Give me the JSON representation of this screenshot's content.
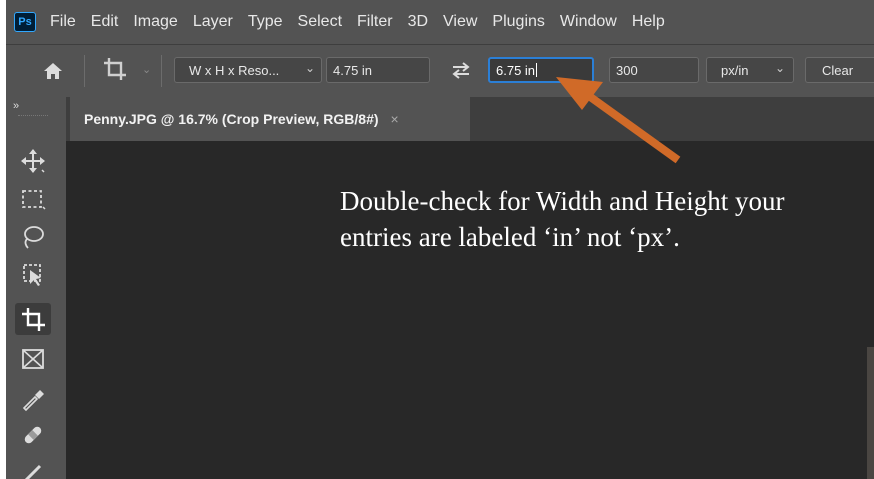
{
  "app": {
    "logo_text": "Ps"
  },
  "menu": {
    "items": [
      "File",
      "Edit",
      "Image",
      "Layer",
      "Type",
      "Select",
      "Filter",
      "3D",
      "View",
      "Plugins",
      "Window",
      "Help"
    ]
  },
  "options_bar": {
    "preset": "W x H x Reso...",
    "width": "4.75 in",
    "height": "6.75 in",
    "resolution": "300",
    "resolution_unit": "px/in",
    "clear_label": "Clear"
  },
  "document_tab": {
    "title": "Penny.JPG @ 16.7% (Crop Preview, RGB/8#)",
    "close_glyph": "×"
  },
  "annotation": {
    "line1": "Double-check for Width and Height your",
    "line2": "entries are labeled ‘in’ not ‘px’."
  },
  "colors": {
    "arrow": "#d06a28",
    "focus_border": "#2b7fd6",
    "panel": "#535353",
    "canvas": "#282828"
  },
  "icons": [
    "home-icon",
    "crop-tool-icon",
    "swap-icon",
    "move-tool-icon",
    "marquee-tool-icon",
    "lasso-tool-icon",
    "object-select-tool-icon",
    "crop-tool-icon",
    "frame-tool-icon",
    "eyedropper-tool-icon",
    "healing-brush-tool-icon",
    "brush-tool-icon"
  ]
}
